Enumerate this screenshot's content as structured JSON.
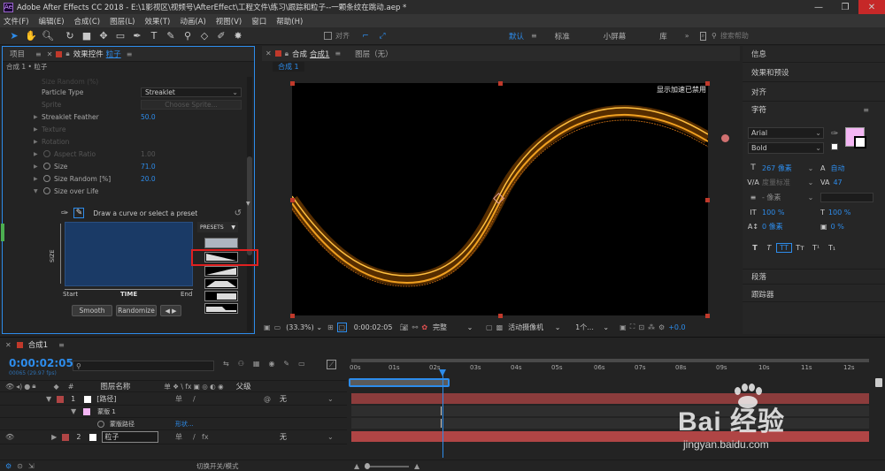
{
  "title_bar": {
    "logo": "Ae",
    "title": "Adobe After Effects CC 2018 - E:\\1影视区\\视频号\\AfterEffect\\工程文件\\练习\\跟踪和粒子--一颗条纹在跳动.aep *",
    "min": "—",
    "max": "❐",
    "close": "✕"
  },
  "menu": [
    "文件(F)",
    "编辑(E)",
    "合成(C)",
    "图层(L)",
    "效果(T)",
    "动画(A)",
    "视图(V)",
    "窗口",
    "帮助(H)"
  ],
  "toolbar": {
    "snap_label": "对齐",
    "workspaces": [
      "默认",
      "标准",
      "小屏幕",
      "库"
    ],
    "search_placeholder": "搜索帮助"
  },
  "left_panel": {
    "tab_project": "项目",
    "tab_effect_prefix": "效果控件",
    "tab_effect_layer": "粒子",
    "breadcrumb": "合成 1 • 粒子",
    "props": [
      {
        "label": "Particle Type",
        "value": "Streaklet",
        "kind": "dropdown"
      },
      {
        "label": "Sprite",
        "value": "Choose Sprite...",
        "kind": "dim"
      },
      {
        "label": "Streaklet Feather",
        "value": "50.0",
        "kind": "value"
      },
      {
        "label": "Texture",
        "value": "",
        "kind": "dim"
      },
      {
        "label": "Rotation",
        "value": "",
        "kind": "dim"
      },
      {
        "label": "Aspect Ratio",
        "value": "1.00",
        "kind": "dim"
      },
      {
        "label": "Size",
        "value": "71.0",
        "kind": "value"
      },
      {
        "label": "Size Random [%]",
        "value": "20.0",
        "kind": "value"
      },
      {
        "label": "Size over Life",
        "value": "",
        "kind": "open"
      }
    ],
    "graph": {
      "instruction": "Draw a curve or select a preset",
      "presets_label": "PRESETS",
      "y_label": "SIZE",
      "x_start": "Start",
      "x_mid": "TIME",
      "x_end": "End",
      "smooth": "Smooth",
      "randomize": "Randomize"
    }
  },
  "viewer": {
    "tab_comp_prefix": "合成",
    "tab_comp_name": "合成1",
    "tab_layer": "图层（无）",
    "sub_tab": "合成 1",
    "hint": "显示加速已禁用",
    "zoom": "(33.3%)",
    "timecode": "0:00:02:05",
    "quality": "完整",
    "camera": "活动摄像机",
    "views": "1个...",
    "exposure": "+0.0"
  },
  "right_panel": {
    "sections": [
      "信息",
      "效果和预设",
      "对齐",
      "字符"
    ],
    "font": "Arial",
    "style": "Bold",
    "size": "267 像素",
    "leading": "自动",
    "kerning": "度量标准",
    "tracking": "47",
    "stroke": "- 像素",
    "vscale": "100 %",
    "hscale": "100 %",
    "baseline": "0 像素",
    "tsume": "0 %",
    "text_styles": [
      "T",
      "T",
      "TT",
      "Tт",
      "T¹",
      "T₁"
    ],
    "more": [
      "段落",
      "跟踪器"
    ]
  },
  "timeline": {
    "comp_tab": "合成1",
    "timecode": "0:00:02:05",
    "frames": "00065 (29.97 fps)",
    "col_name": "图层名称",
    "col_switches": "单 ❖ \\ fx ▣ ◎ ◐ ◉",
    "col_parent": "父级",
    "layers": [
      {
        "num": "1",
        "name": "[路径]",
        "parent": "无"
      },
      {
        "num": "",
        "name": "蒙版 1",
        "parent": ""
      },
      {
        "num": "",
        "name": "蒙版路径",
        "parent": "形状..."
      },
      {
        "num": "2",
        "name": "粒子",
        "parent": "无"
      }
    ],
    "ruler": [
      "00s",
      "01s",
      "02s",
      "03s",
      "04s",
      "05s",
      "06s",
      "07s",
      "08s",
      "09s",
      "10s",
      "11s",
      "12s"
    ],
    "toggle_label": "切换开关/模式"
  },
  "watermark": {
    "brand": "Bai 经验",
    "url": "jingyan.baidu.com"
  },
  "colors": {
    "accent": "#2d8ceb",
    "layer_red": "#b04545",
    "particle": "#f0a020"
  }
}
